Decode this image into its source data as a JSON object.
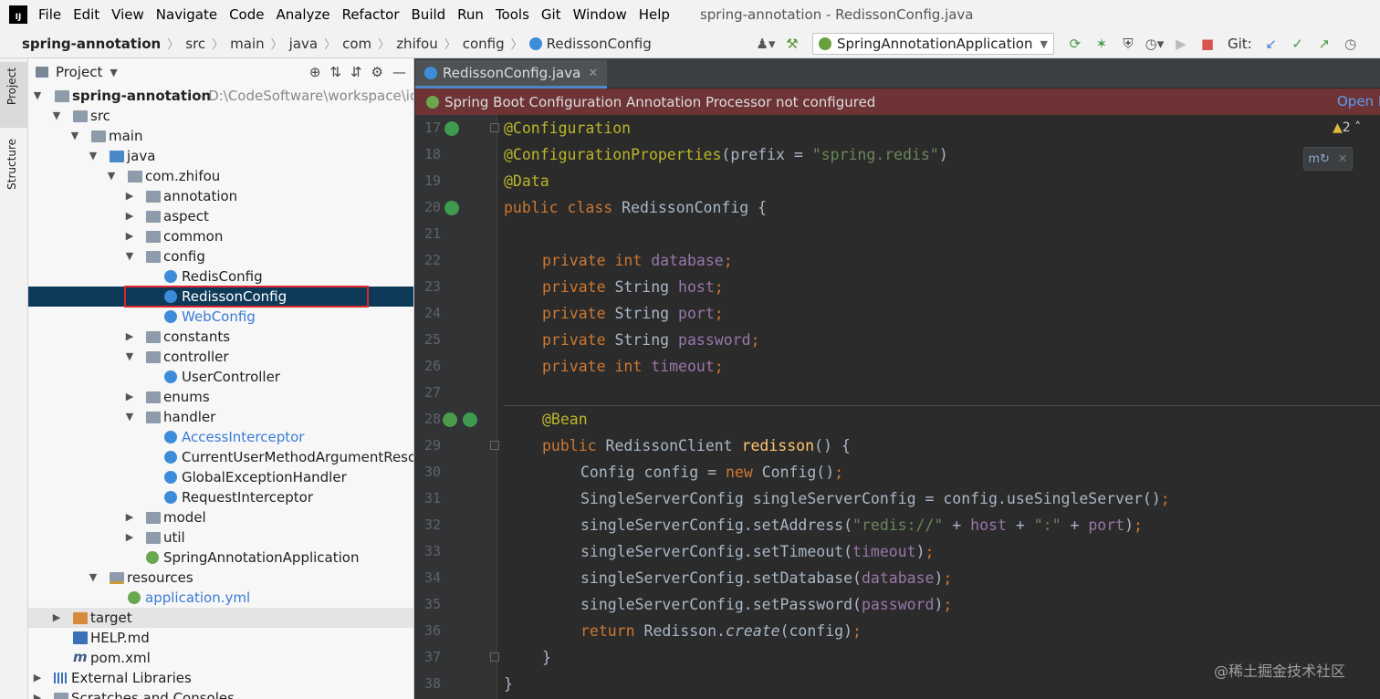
{
  "menubar": {
    "logo_text": "IJ",
    "items": [
      "File",
      "Edit",
      "View",
      "Navigate",
      "Code",
      "Analyze",
      "Refactor",
      "Build",
      "Run",
      "Tools",
      "Git",
      "Window",
      "Help"
    ],
    "window_title": "spring-annotation - RedissonConfig.java"
  },
  "navbar": {
    "crumbs": [
      "spring-annotation",
      "src",
      "main",
      "java",
      "com",
      "zhifou",
      "config",
      "RedissonConfig"
    ],
    "run_config": "SpringAnnotationApplication",
    "git_label": "Git:"
  },
  "sidebar_strip": {
    "project_tab": "Project",
    "structure_tab": "Structure"
  },
  "project_panel": {
    "title": "Project",
    "tree": [
      {
        "label": "spring-annotation",
        "path": " - D:\\CodeSoftware\\workspace\\idea",
        "bold": true
      },
      {
        "label": "src"
      },
      {
        "label": "main"
      },
      {
        "label": "java"
      },
      {
        "label": "com.zhifou"
      },
      {
        "label": "annotation"
      },
      {
        "label": "aspect"
      },
      {
        "label": "common"
      },
      {
        "label": "config"
      },
      {
        "label": "RedisConfig"
      },
      {
        "label": "RedissonConfig",
        "selected": true
      },
      {
        "label": "WebConfig"
      },
      {
        "label": "constants"
      },
      {
        "label": "controller"
      },
      {
        "label": "UserController"
      },
      {
        "label": "enums"
      },
      {
        "label": "handler"
      },
      {
        "label": "AccessInterceptor"
      },
      {
        "label": "CurrentUserMethodArgumentResolver"
      },
      {
        "label": "GlobalExceptionHandler"
      },
      {
        "label": "RequestInterceptor"
      },
      {
        "label": "model"
      },
      {
        "label": "util"
      },
      {
        "label": "SpringAnnotationApplication"
      },
      {
        "label": "resources"
      },
      {
        "label": "application.yml"
      },
      {
        "label": "target"
      },
      {
        "label": "HELP.md"
      },
      {
        "label": "pom.xml"
      },
      {
        "label": "External Libraries"
      },
      {
        "label": "Scratches and Consoles"
      }
    ]
  },
  "editor": {
    "tab_label": "RedissonConfig.java",
    "banner_text": "Spring Boot Configuration Annotation Processor not configured",
    "banner_action": "Open D",
    "warning_count": "2",
    "line_numbers": [
      "17",
      "18",
      "19",
      "20",
      "21",
      "22",
      "23",
      "24",
      "25",
      "26",
      "27",
      "28",
      "29",
      "30",
      "31",
      "32",
      "33",
      "34",
      "35",
      "36",
      "37",
      "38"
    ],
    "code": {
      "l17": "@Configuration",
      "l18a": "@ConfigurationProperties",
      "l18b": "(prefix = ",
      "l18c": "\"spring.redis\"",
      "l18d": ")",
      "l19": "@Data",
      "l20a": "public class ",
      "l20b": "RedissonConfig {",
      "kw_private": "private ",
      "kw_int": "int ",
      "t_string": "String ",
      "f_database": "database",
      "f_host": "host",
      "f_port": "port",
      "f_password": "password",
      "f_timeout": "timeout",
      "semi": ";",
      "l28": "@Bean",
      "l29a": "public ",
      "l29b": "RedissonClient ",
      "l29c": "redisson",
      "l29d": "() {",
      "l30a": "Config config = ",
      "l30b": "new ",
      "l30c": "Config()",
      "l30d": ";",
      "l31a": "SingleServerConfig singleServerConfig = config.useSingleServer()",
      "l31b": ";",
      "l32a": "singleServerConfig.setAddress(",
      "l32b": "\"redis://\"",
      "l32c": " + ",
      "l32d": "host",
      "l32e": " + ",
      "l32f": "\":\"",
      "l32g": " + ",
      "l32h": "port",
      "l32i": ")",
      "l32j": ";",
      "l33a": "singleServerConfig.setTimeout(",
      "l33b": "timeout",
      "l33c": ")",
      "l33d": ";",
      "l34a": "singleServerConfig.setDatabase(",
      "l34b": "database",
      "l34c": ")",
      "l34d": ";",
      "l35a": "singleServerConfig.setPassword(",
      "l35b": "password",
      "l35c": ")",
      "l35d": ";",
      "l36a": "return ",
      "l36b": "Redisson.",
      "l36c": "create",
      "l36d": "(config)",
      "l36e": ";",
      "l37": "}",
      "l38": "}"
    }
  },
  "watermark": "@稀土掘金技术社区"
}
